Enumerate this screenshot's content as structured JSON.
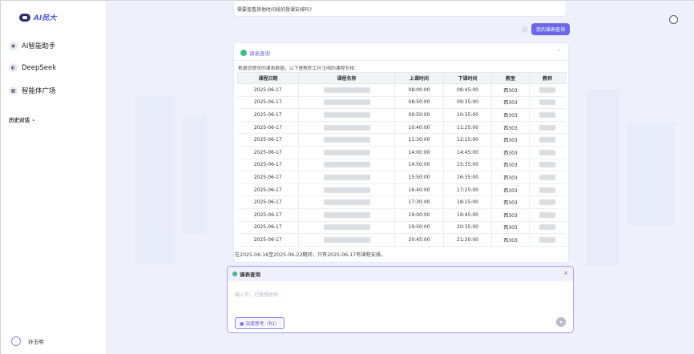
{
  "sidebar": {
    "logo_text": "AI民大",
    "nav": [
      {
        "label": "AI智能助手",
        "icon": "robot-icon"
      },
      {
        "label": "DeepSeek",
        "icon": "deepseek-icon"
      },
      {
        "label": "智能体广场",
        "icon": "grid-icon"
      }
    ],
    "history_label": "历史对话",
    "user_name": "孙玉明"
  },
  "chat": {
    "top_message": "需要查看其他时间段的授课安排吗?",
    "user_message": "我的课表查询"
  },
  "result_card": {
    "title": "课表查询",
    "intro": "根据您提供的课表数据，以下是教职工孙玉明的课程安排：",
    "columns": [
      "课程日期",
      "课程名称",
      "上课时间",
      "下课时间",
      "教室",
      "教师"
    ],
    "rows": [
      {
        "date": "2025-06-17",
        "start": "08:00:00",
        "end": "08:45:00",
        "room": "西303"
      },
      {
        "date": "2025-06-17",
        "start": "08:50:00",
        "end": "09:35:00",
        "room": "西303"
      },
      {
        "date": "2025-06-17",
        "start": "09:50:00",
        "end": "10:35:00",
        "room": "西303"
      },
      {
        "date": "2025-06-17",
        "start": "10:40:00",
        "end": "11:25:00",
        "room": "西303"
      },
      {
        "date": "2025-06-17",
        "start": "11:30:00",
        "end": "12:15:00",
        "room": "西303"
      },
      {
        "date": "2025-06-17",
        "start": "14:00:00",
        "end": "14:45:00",
        "room": "西303"
      },
      {
        "date": "2025-06-17",
        "start": "14:50:00",
        "end": "15:35:00",
        "room": "西303"
      },
      {
        "date": "2025-06-17",
        "start": "15:50:00",
        "end": "16:35:00",
        "room": "西303"
      },
      {
        "date": "2025-06-17",
        "start": "16:40:00",
        "end": "17:25:00",
        "room": "西303"
      },
      {
        "date": "2025-06-17",
        "start": "17:30:00",
        "end": "18:15:00",
        "room": "西303"
      },
      {
        "date": "2025-06-17",
        "start": "19:00:00",
        "end": "19:45:00",
        "room": "西303"
      },
      {
        "date": "2025-06-17",
        "start": "19:50:00",
        "end": "20:35:00",
        "room": "西303"
      },
      {
        "date": "2025-06-17",
        "start": "20:45:00",
        "end": "21:30:00",
        "room": "西303"
      }
    ],
    "summary": "在2025-06-16至2025-06-22期间，只有2025-06-17有课程安排。"
  },
  "input_panel": {
    "title": "课表查询",
    "placeholder": "输入你，已暂想居休...",
    "deep_think_label": "深度思考（R1）"
  },
  "colors": {
    "accent": "#6b67e8",
    "background": "#eef1fb"
  }
}
